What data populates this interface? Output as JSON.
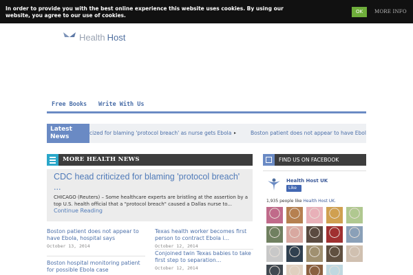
{
  "cookie": {
    "text": "In order to provide you with the best online experience this website uses cookies. By using our website, you agree to our use of cookies.",
    "ok_label": "OK",
    "more_label": "MORE INFO"
  },
  "logo": {
    "health": "Health",
    "host": "Host"
  },
  "nav": {
    "items": [
      "Free Books",
      "Write With Us"
    ]
  },
  "ticker": {
    "label": "Latest News",
    "items": [
      "cized for blaming 'protocol breach' as nurse gets Ebola",
      "Boston patient does not appear to have Ebola, h"
    ],
    "separator": "▸"
  },
  "section": {
    "title": "MORE HEALTH  NEWS"
  },
  "featured": {
    "title": "CDC head criticized for blaming 'protocol breach' ...",
    "excerpt": "CHICAGO (Reuters) – Some healthcare experts are bristling at the assertion by a top U.S. health official that a \"protocol breach\" caused a Dallas nurse to...",
    "more": "Continue Reading"
  },
  "articles": [
    {
      "title": "Boston patient does not appear to have Ebola, hospital says",
      "date": "October 13, 2014"
    },
    {
      "title": "Texas health worker becomes first person to contract Ebola i...",
      "date": "October 12, 2014"
    },
    {
      "title": "Conjoined twin Texas babies to take first step to separation...",
      "date": "October 12, 2014"
    },
    {
      "title": "Boston hospital monitoring patient for possible Ebola case",
      "date": ""
    }
  ],
  "facebook": {
    "header": "FIND US ON FACEBOOK",
    "page_name": "Health Host UK",
    "like_label": "Like",
    "count_text": "1,935 people like",
    "count_link": "Health Host UK.",
    "faces": [
      "#c06a8a",
      "#b68050",
      "#e8b0b8",
      "#d0a050",
      "#b0c890",
      "#708060",
      "#d8a8a0",
      "#5a4a40",
      "#a03030",
      "#8aa0b8",
      "#c8c8c8",
      "#304050",
      "#a09070",
      "#605040",
      "#d0c0b0",
      "#404850",
      "#e0d0c0",
      "#8a6040",
      "#c0d8e0"
    ]
  },
  "colors": {
    "accent": "#6a8ac4",
    "link": "#4a6ea8",
    "dark": "#3d3d3d",
    "teal": "#2aa7c9",
    "ok": "#6fae3b"
  }
}
